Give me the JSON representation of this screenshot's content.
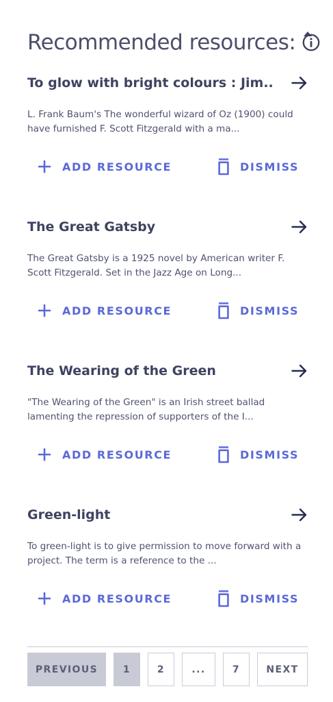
{
  "header": {
    "title": "Recommended resources:",
    "info_icon": "info-circle-icon",
    "collapse_icon": "caret-up-icon"
  },
  "colors": {
    "accent": "#5a69d8",
    "text": "#4b4f6a",
    "border": "#c9cbd6",
    "active_fill": "#c8cad6"
  },
  "resources": [
    {
      "title": "To glow with bright colours : Jim...",
      "description": "L. Frank Baum's The wonderful wizard of Oz (1900) could have furnished F. Scott Fitzgerald with a ma...",
      "add_label": "ADD RESOURCE",
      "dismiss_label": "DISMISS"
    },
    {
      "title": "The Great Gatsby",
      "description": "The Great Gatsby is a 1925 novel by American writer F. Scott Fitzgerald. Set in the Jazz Age on Long...",
      "add_label": "ADD RESOURCE",
      "dismiss_label": "DISMISS"
    },
    {
      "title": "The Wearing of the Green",
      "description": "\"The Wearing of the Green\" is an Irish street ballad lamenting the repression of supporters of the I...",
      "add_label": "ADD RESOURCE",
      "dismiss_label": "DISMISS"
    },
    {
      "title": "Green-light",
      "description": "To green-light is to give permission to move forward with a project. The term is a reference to the ...",
      "add_label": "ADD RESOURCE",
      "dismiss_label": "DISMISS"
    }
  ],
  "pagination": {
    "previous_label": "PREVIOUS",
    "pages": [
      "1",
      "2",
      "...",
      "7"
    ],
    "current_page": "1",
    "next_label": "NEXT"
  }
}
